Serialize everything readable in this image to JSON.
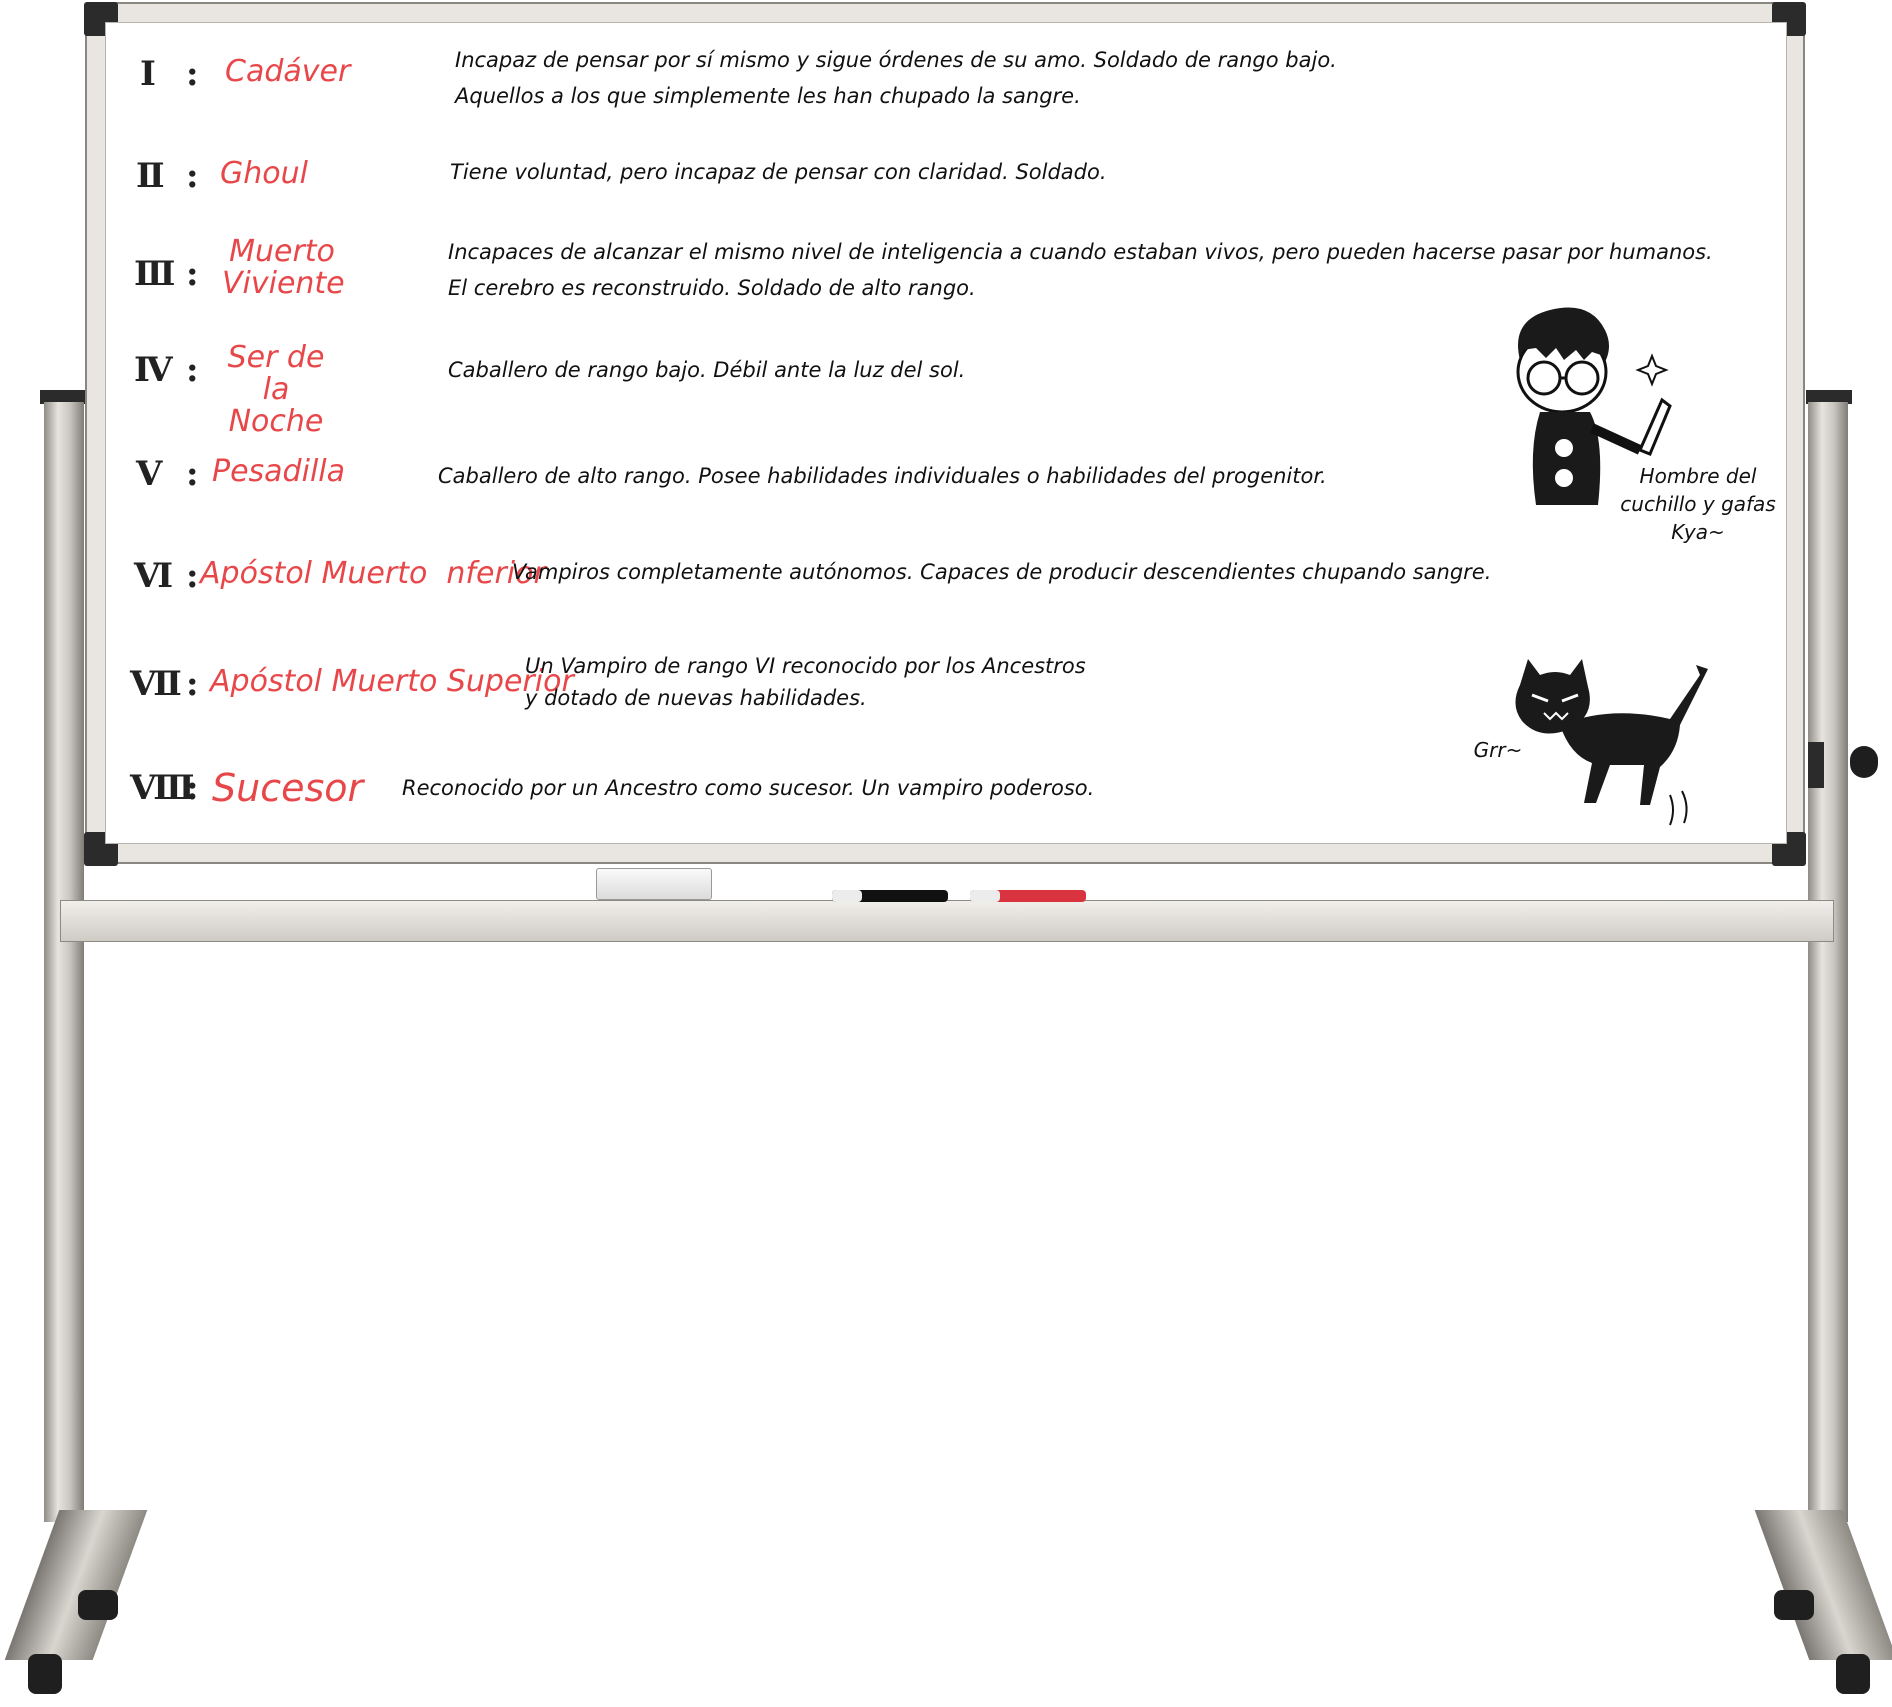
{
  "ranks": [
    {
      "numeral": "Ⅰ",
      "sep": ":",
      "term": "Cadáver",
      "desc": [
        "Incapaz de pensar por sí mismo y sigue órdenes de su amo. Soldado de rango bajo.",
        "Aquellos a los que simplemente les han chupado la sangre."
      ]
    },
    {
      "numeral": "Ⅱ",
      "sep": ":",
      "term": "Ghoul",
      "desc": [
        "Tiene voluntad, pero incapaz de pensar con claridad. Soldado."
      ]
    },
    {
      "numeral": "Ⅲ",
      "sep": ":",
      "term": "Muerto Viviente",
      "desc": [
        "Incapaces de alcanzar el mismo nivel de inteligencia a cuando estaban vivos, pero pueden hacerse pasar por humanos.",
        "El cerebro es reconstruido. Soldado de alto rango."
      ]
    },
    {
      "numeral": "Ⅳ",
      "sep": ":",
      "term": "Ser de la Noche",
      "desc": [
        "Caballero de rango bajo. Débil ante la luz del sol."
      ]
    },
    {
      "numeral": "Ⅴ",
      "sep": ":",
      "term": "Pesadilla",
      "desc": [
        "Caballero de alto rango. Posee habilidades individuales o habilidades del progenitor."
      ]
    },
    {
      "numeral": "Ⅵ",
      "sep": ":",
      "term": "Apóstol Muerto  nferior",
      "desc": [
        "Vampiros completamente autónomos. Capaces de producir descendientes chupando sangre."
      ]
    },
    {
      "numeral": "Ⅶ",
      "sep": ":",
      "term": "Apóstol Muerto Superior",
      "desc": [
        "Un Vampiro de rango VI reconocido por los Ancestros",
        "y dotado de nuevas habilidades."
      ]
    },
    {
      "numeral": "Ⅷ",
      "sep": ":",
      "term": "Sucesor",
      "desc": [
        "Reconocido por un Ancestro como sucesor. Un vampiro poderoso."
      ]
    }
  ],
  "doodles": {
    "boy_caption": [
      "Hombre del",
      "cuchillo y gafas",
      "Kya~"
    ],
    "cat_caption": "Grr~"
  },
  "colors": {
    "term_red": "#e8474a",
    "ink": "#111111",
    "frame": "#e9e6e1"
  },
  "icons": [
    "whiteboard",
    "eraser-icon",
    "black-marker-icon",
    "red-marker-icon",
    "glasses-boy-doodle",
    "angry-cat-doodle"
  ]
}
